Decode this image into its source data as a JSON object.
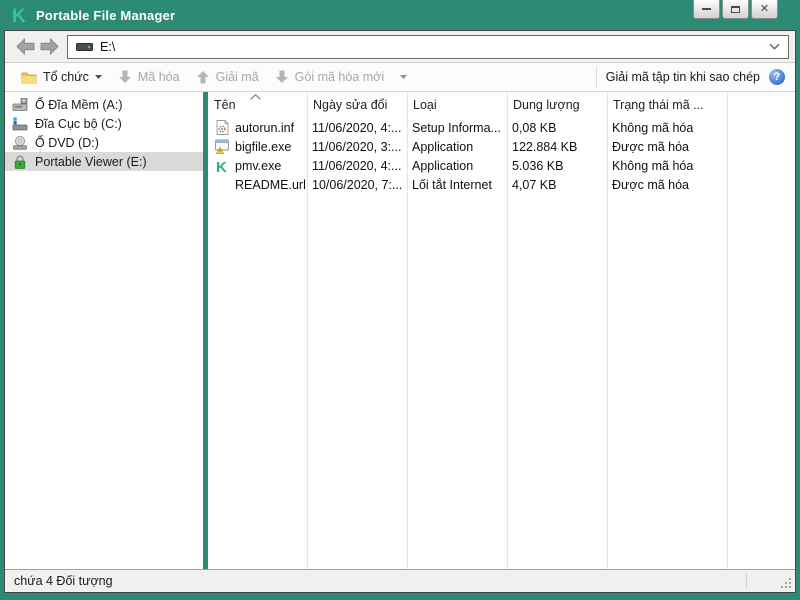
{
  "window": {
    "title": "Portable File Manager",
    "control_icons": [
      "minimize-icon",
      "maximize-icon",
      "close-icon"
    ]
  },
  "colors": {
    "titlebar_teal": "#2D8A74",
    "logo_teal": "#35C3A3",
    "chrome_gray": "#F0F0F0",
    "selection_gray": "#D9D9D9",
    "help_blue": "#3A74CF",
    "lock_green": "#3FA63C",
    "disabled_text": "#A6A6A6"
  },
  "navbar": {
    "address": "E:\\",
    "icons": [
      "back-icon",
      "forward-icon",
      "drive-icon",
      "chevron-down-icon"
    ]
  },
  "toolbar": {
    "organize_label": "Tổ chức",
    "encrypt_label": "Mã hóa",
    "decrypt_label": "Giải mã",
    "new_package_label": "Gói mã hóa mới",
    "decrypt_on_copy_label": "Giải mã tập tin khi sao chép",
    "help_glyph": "?"
  },
  "sidebar": {
    "items": [
      {
        "label": "Ổ Đĩa Mềm (A:)",
        "icon": "floppy-drive-icon",
        "selected": false
      },
      {
        "label": "Đĩa Cục bộ (C:)",
        "icon": "local-disk-icon",
        "selected": false
      },
      {
        "label": "Ổ DVD (D:)",
        "icon": "dvd-drive-icon",
        "selected": false
      },
      {
        "label": "Portable Viewer (E:)",
        "icon": "lock-icon",
        "selected": true
      }
    ]
  },
  "filelist": {
    "columns": [
      "Tên",
      "Ngày sửa đổi",
      "Loại",
      "Dung lượng",
      "Trạng thái mã ..."
    ],
    "sort_column": "Tên",
    "sort_direction": "asc",
    "rows": [
      {
        "name": "autorun.inf",
        "icon": "inf-file-icon",
        "modified": "11/06/2020, 4:...",
        "type": "Setup Informa...",
        "size": "0,08 KB",
        "status": "Không mã hóa"
      },
      {
        "name": "bigfile.exe",
        "icon": "exe-file-icon",
        "modified": "11/06/2020, 3:...",
        "type": "Application",
        "size": "122.884 KB",
        "status": "Được mã hóa"
      },
      {
        "name": "pmv.exe",
        "icon": "kaspersky-app-icon",
        "modified": "11/06/2020, 4:...",
        "type": "Application",
        "size": "5.036 KB",
        "status": "Không mã hóa"
      },
      {
        "name": "README.url",
        "icon": "blank-icon",
        "modified": "10/06/2020, 7:...",
        "type": "Lối tắt Internet",
        "size": "4,07 KB",
        "status": "Được mã hóa"
      }
    ]
  },
  "statusbar": {
    "text": "chứa 4 Đối tượng"
  }
}
